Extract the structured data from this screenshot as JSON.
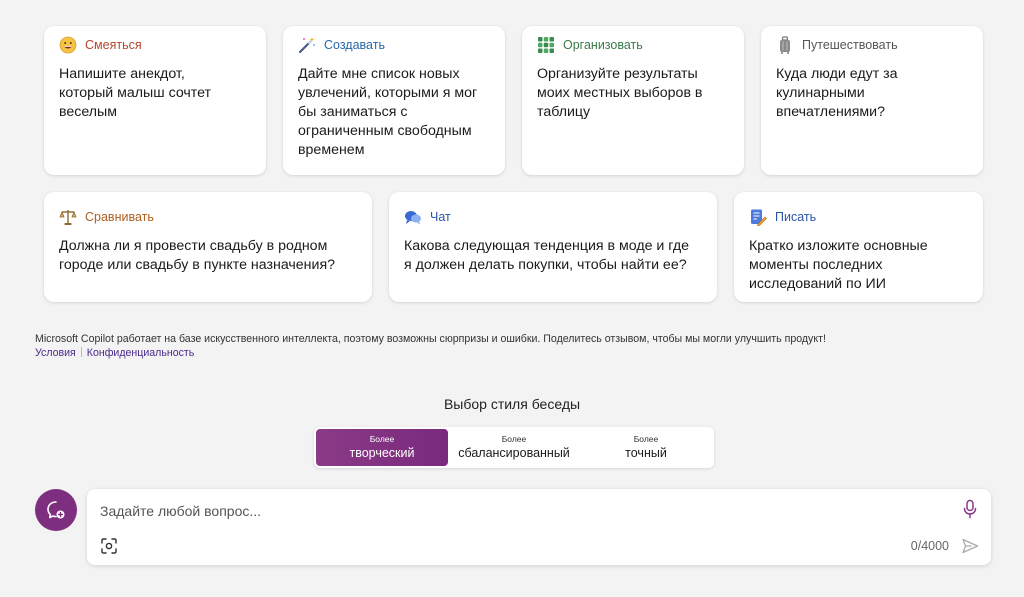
{
  "cards": [
    {
      "category": "Смеяться",
      "text": "Напишите анекдот, который малыш сочтет веселым",
      "color": "#b5452e",
      "icon": "grinning-face-icon"
    },
    {
      "category": "Создавать",
      "text": "Дайте мне список новых увлечений, которыми я мог бы заниматься с ограниченным свободным временем",
      "color": "#2a66a8",
      "icon": "magic-wand-icon"
    },
    {
      "category": "Организовать",
      "text": "Организуйте результаты моих местных выборов в таблицу",
      "color": "#3a7a4a",
      "icon": "grid-table-icon"
    },
    {
      "category": "Путешествовать",
      "text": "Куда люди едут за кулинарными впечатлениями?",
      "color": "#555555",
      "icon": "luggage-icon"
    },
    {
      "category": "Сравнивать",
      "text": "Должна ли я провести свадьбу в родном городе или свадьбу в пункте назначения?",
      "color": "#b06020",
      "icon": "scales-icon"
    },
    {
      "category": "Чат",
      "text": "Какова следующая тенденция в моде и где я должен делать покупки, чтобы найти ее?",
      "color": "#2a55a8",
      "icon": "chat-bubbles-icon"
    },
    {
      "category": "Писать",
      "text": "Кратко изложите основные моменты последних исследований по ИИ",
      "color": "#2a55a8",
      "icon": "memo-pencil-icon"
    }
  ],
  "disclaimer": "Microsoft Copilot работает на базе искусственного интеллекта, поэтому возможны сюрпризы и ошибки. Поделитесь отзывом, чтобы мы могли улучшить продукт!",
  "links": {
    "terms": "Условия",
    "privacy": "Конфиденциальность"
  },
  "style_selector": {
    "title": "Выбор стиля беседы",
    "options": [
      {
        "small": "Более",
        "big": "творческий"
      },
      {
        "small": "Более",
        "big": "сбалансированный"
      },
      {
        "small": "Более",
        "big": "точный"
      }
    ],
    "active": "творческий",
    "active_color": "#7d2c7f"
  },
  "input": {
    "placeholder": "Задайте любой вопрос...",
    "value": "",
    "counter": "0/4000"
  },
  "accent": "#7d2e7f"
}
